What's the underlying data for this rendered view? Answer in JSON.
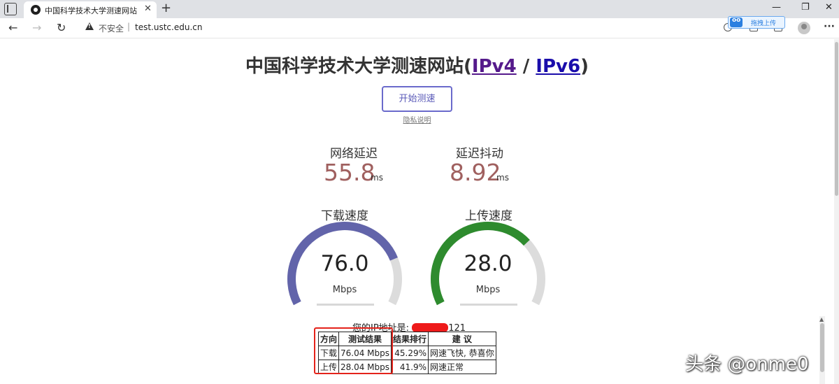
{
  "browser": {
    "tab_title": "中国科学技术大学测速网站",
    "tab_close": "✕",
    "new_tab": "+",
    "controls": {
      "minimize": "—",
      "maximize": "❐",
      "close": "✕"
    },
    "nav": {
      "back": "←",
      "forward": "→",
      "reload": "↻"
    },
    "address": {
      "security_label": "不安全",
      "separator": "|",
      "url": "test.ustc.edu.cn"
    },
    "extension_label": "拖拽上传",
    "menu": "···"
  },
  "page": {
    "title_prefix": "中国科学技术大学测速网站(",
    "ipv4": "IPv4",
    "slash": " / ",
    "ipv6": "IPv6",
    "title_suffix": ")",
    "start_button": "开始测速",
    "privacy_link": "隐私说明",
    "ping": {
      "label": "网络延迟",
      "value": "55.8",
      "unit": "ms"
    },
    "jitter": {
      "label": "延迟抖动",
      "value": "8.92",
      "unit": "ms"
    },
    "download": {
      "label": "下载速度",
      "value": "76.0",
      "unit": "Mbps",
      "fill": 0.79,
      "color": "#6264aa"
    },
    "upload": {
      "label": "上传速度",
      "value": "28.0",
      "unit": "Mbps",
      "fill": 0.7,
      "color": "#2e8b2e"
    },
    "ip_label": "您的IP地址是:",
    "ip_suffix": "121",
    "table": {
      "headers": [
        "方向",
        "测试结果",
        "结果排行",
        "建 议"
      ],
      "rows": [
        [
          "下载",
          "76.04 Mbps",
          "45.29%",
          "网速飞快, 恭喜你"
        ],
        [
          "上传",
          "28.04 Mbps",
          "41.9%",
          "网速正常"
        ]
      ]
    }
  },
  "watermark": "头条 @onme0"
}
